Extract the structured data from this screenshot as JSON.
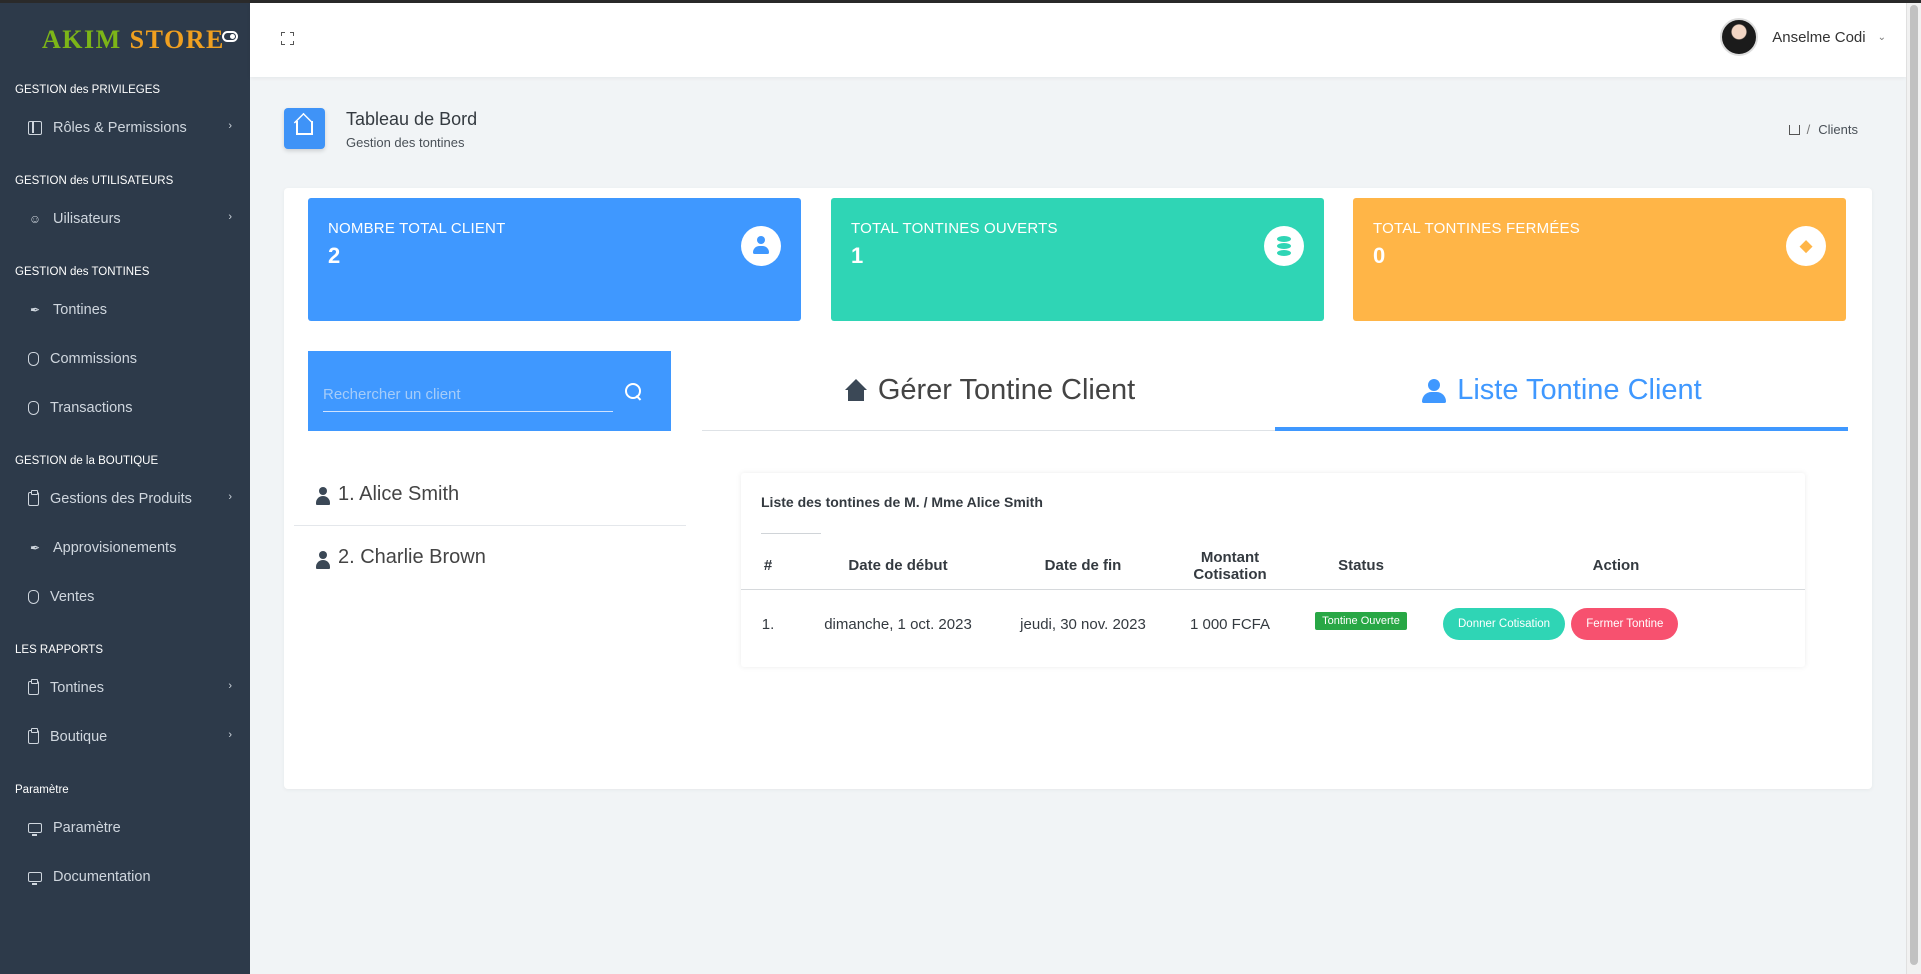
{
  "app": {
    "logo_part1": "AKIM ",
    "logo_part2": "STORE"
  },
  "sidebar": {
    "sections": [
      {
        "title": "GESTION des PRIVILEGES",
        "items": [
          {
            "label": "Rôles & Permissions",
            "icon": "layout-icon",
            "has_children": true
          }
        ]
      },
      {
        "title": "GESTION des UTILISATEURS",
        "items": [
          {
            "label": "Uilisateurs",
            "icon": "users-icon",
            "has_children": true
          }
        ]
      },
      {
        "title": "GESTION des TONTINES",
        "items": [
          {
            "label": "Tontines",
            "icon": "feather-icon",
            "has_children": false
          },
          {
            "label": "Commissions",
            "icon": "shield-icon",
            "has_children": false
          },
          {
            "label": "Transactions",
            "icon": "shield-icon",
            "has_children": false
          }
        ]
      },
      {
        "title": "GESTION de la BOUTIQUE",
        "items": [
          {
            "label": "Gestions des Produits",
            "icon": "clipboard-icon",
            "has_children": true
          },
          {
            "label": "Approvisionements",
            "icon": "feather-icon",
            "has_children": false
          },
          {
            "label": "Ventes",
            "icon": "shield-icon",
            "has_children": false
          }
        ]
      },
      {
        "title": "LES RAPPORTS",
        "items": [
          {
            "label": "Tontines",
            "icon": "clipboard-icon",
            "has_children": true
          },
          {
            "label": "Boutique",
            "icon": "clipboard-icon",
            "has_children": true
          }
        ]
      },
      {
        "title": "Paramètre",
        "items": [
          {
            "label": "Paramètre",
            "icon": "monitor-icon",
            "has_children": false
          },
          {
            "label": "Documentation",
            "icon": "monitor-icon",
            "has_children": false
          }
        ]
      }
    ]
  },
  "header": {
    "user_name": "Anselme Codi"
  },
  "page": {
    "title": "Tableau de Bord",
    "subtitle": "Gestion des tontines",
    "breadcrumb_current": "Clients"
  },
  "stats": [
    {
      "label": "NOMBRE TOTAL CLIENT",
      "value": "2",
      "icon": "user-icon",
      "color": "#3f98ff"
    },
    {
      "label": "TOTAL TONTINES OUVERTS",
      "value": "1",
      "icon": "database-icon",
      "color": "#2fd5b5"
    },
    {
      "label": "TOTAL TONTINES FERMÉES",
      "value": "0",
      "icon": "tags-icon",
      "color": "#ffb547"
    }
  ],
  "search": {
    "placeholder": "Rechercher un client"
  },
  "clients": [
    {
      "label": "1. Alice Smith"
    },
    {
      "label": "2. Charlie Brown"
    }
  ],
  "tabs": [
    {
      "label": "Gérer Tontine Client",
      "active": false
    },
    {
      "label": "Liste Tontine Client",
      "active": true
    }
  ],
  "tontine_table": {
    "title": "Liste des tontines de M. / Mme Alice Smith",
    "headers": [
      "#",
      "Date de début",
      "Date de fin",
      "Montant Cotisation",
      "Status",
      "Action"
    ],
    "rows": [
      {
        "index": "1.",
        "start": "dimanche, 1 oct. 2023",
        "end": "jeudi, 30 nov. 2023",
        "amount": "1 000 FCFA",
        "status": "Tontine Ouverte",
        "action_primary": "Donner Cotisation",
        "action_secondary": "Fermer Tontine"
      }
    ]
  },
  "colors": {
    "sidebar_bg": "#2d3a4a",
    "primary": "#3f98ff",
    "teal": "#2fd5b5",
    "orange": "#ffb547",
    "success": "#28a745",
    "danger": "#f7516f"
  }
}
